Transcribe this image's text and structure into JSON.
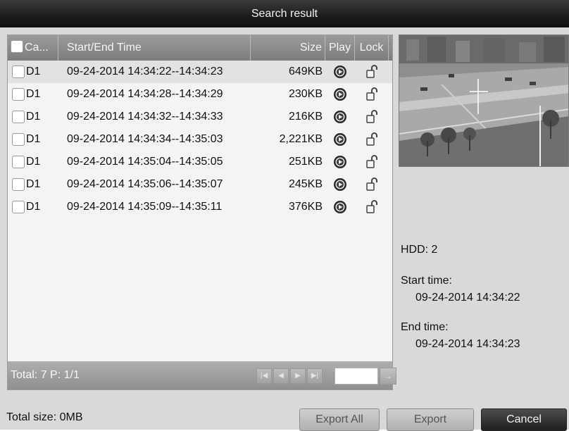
{
  "window": {
    "title": "Search result"
  },
  "list": {
    "columns": {
      "camera": "Ca...",
      "time": "Start/End Time",
      "size": "Size",
      "play": "Play",
      "lock": "Lock"
    },
    "rows": [
      {
        "camera": "D1",
        "time": "09-24-2014 14:34:22--14:34:23",
        "size": "649KB",
        "selected": true
      },
      {
        "camera": "D1",
        "time": "09-24-2014 14:34:28--14:34:29",
        "size": "230KB"
      },
      {
        "camera": "D1",
        "time": "09-24-2014 14:34:32--14:34:33",
        "size": "216KB"
      },
      {
        "camera": "D1",
        "time": "09-24-2014 14:34:34--14:35:03",
        "size": "2,221KB"
      },
      {
        "camera": "D1",
        "time": "09-24-2014 14:35:04--14:35:05",
        "size": "251KB"
      },
      {
        "camera": "D1",
        "time": "09-24-2014 14:35:06--14:35:07",
        "size": "245KB"
      },
      {
        "camera": "D1",
        "time": "09-24-2014 14:35:09--14:35:11",
        "size": "376KB"
      }
    ],
    "footer": {
      "total_label": "Total: 7  P: 1/1"
    },
    "icons": {
      "play": "play-circle-icon",
      "lock": "unlocked-padlock-icon",
      "first": "first-page-icon",
      "prev": "prev-page-icon",
      "next": "next-page-icon",
      "last": "last-page-icon",
      "go": "go-arrow-icon"
    }
  },
  "details": {
    "hdd": "HDD: 2",
    "start_label": "Start time:",
    "start_value": "09-24-2014 14:34:22",
    "end_label": "End time:",
    "end_value": "09-24-2014 14:34:23"
  },
  "bottom": {
    "total_size": "Total size: 0MB",
    "export_all": "Export All",
    "export": "Export",
    "cancel": "Cancel"
  },
  "colors": {
    "titlebar": "#1c1c1c",
    "header": "#8a8a8a",
    "selected_row": "#e2e2e2",
    "cancel_button": "#2a2a2a"
  }
}
